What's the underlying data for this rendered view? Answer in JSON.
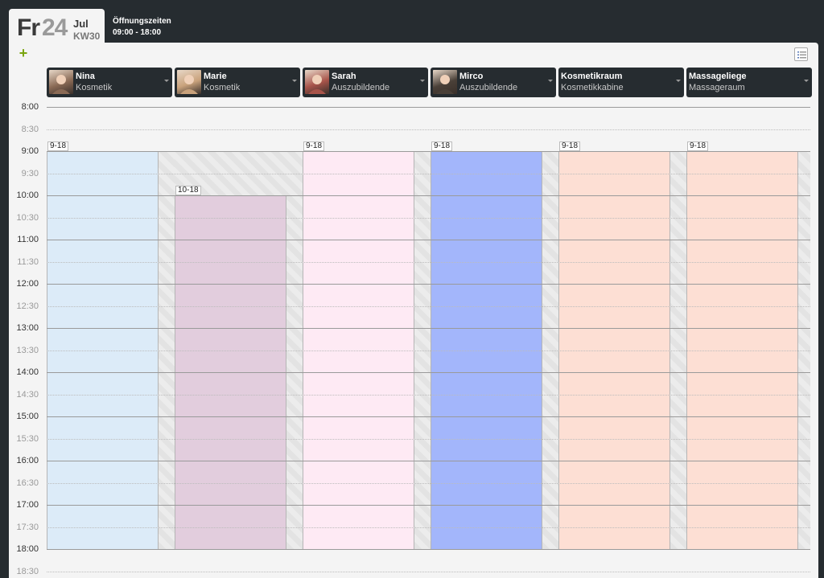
{
  "header": {
    "weekday": "Fr",
    "day": "24",
    "month": "Jul",
    "week": "KW30",
    "hours_title": "Öffnungszeiten",
    "hours_value": "09:00 - 18:00"
  },
  "toolbar": {
    "add_icon": "plus-icon",
    "list_icon": "list-view-icon"
  },
  "times": [
    "8:00",
    "8:30",
    "9:00",
    "9:30",
    "10:00",
    "10:30",
    "11:00",
    "11:30",
    "12:00",
    "12:30",
    "13:00",
    "13:30",
    "14:00",
    "14:30",
    "15:00",
    "15:30",
    "16:00",
    "16:30",
    "17:00",
    "17:30",
    "18:00",
    "18:30"
  ],
  "resources": [
    {
      "name": "Nina",
      "role": "Kosmetik",
      "avatar": true,
      "avatar_color": "#8a6a55",
      "shift_label": "9-18",
      "shift_start": 9,
      "shift_end": 18,
      "color": "#dcebf8"
    },
    {
      "name": "Marie",
      "role": "Kosmetik",
      "avatar": true,
      "avatar_color": "#c9a27c",
      "shift_label": "10-18",
      "shift_start": 10,
      "shift_end": 18,
      "color": "#e2cddd"
    },
    {
      "name": "Sarah",
      "role": "Auszubildende",
      "avatar": true,
      "avatar_color": "#a8544a",
      "shift_label": "9-18",
      "shift_start": 9,
      "shift_end": 18,
      "color": "#feeaf4"
    },
    {
      "name": "Mirco",
      "role": "Auszubildende",
      "avatar": true,
      "avatar_color": "#4a4038",
      "shift_label": "9-18",
      "shift_start": 9,
      "shift_end": 18,
      "color": "#a3b6fb"
    },
    {
      "name": "Kosmetikraum",
      "role": "Kosmetikkabine",
      "avatar": false,
      "shift_label": "9-18",
      "shift_start": 9,
      "shift_end": 18,
      "color": "#fddfd4"
    },
    {
      "name": "Massageliege",
      "role": "Massageraum",
      "avatar": false,
      "shift_label": "9-18",
      "shift_start": 9,
      "shift_end": 18,
      "color": "#fddfd4"
    }
  ]
}
